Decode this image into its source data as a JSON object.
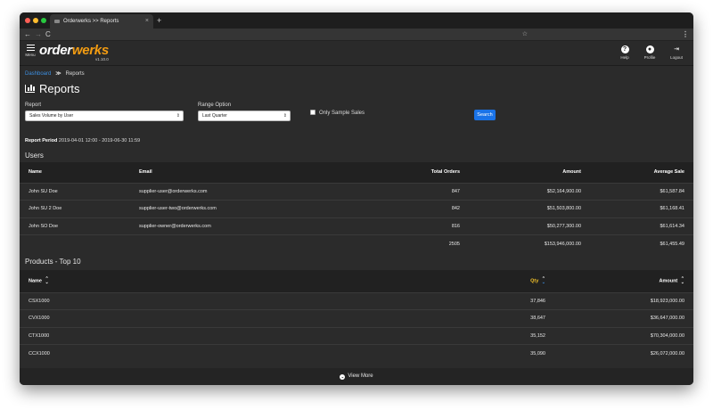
{
  "browser": {
    "tab_title": "Orderwerks >> Reports",
    "tab_close": "×",
    "new_tab": "+",
    "back": "←",
    "forward": "→",
    "reload": "C",
    "bookmark": "☆",
    "menu": "⋮"
  },
  "header": {
    "menu_label": "Menu",
    "logo_part1": "order",
    "logo_part2": "werks",
    "version": "v1.10.0",
    "actions": [
      {
        "label": "Help",
        "icon": "?"
      },
      {
        "label": "Profile",
        "icon": "●"
      },
      {
        "label": "Logout",
        "icon": "⇥"
      }
    ],
    "accent_color": "#f39c12"
  },
  "breadcrumb": {
    "home": "Dashboard",
    "separator": "≫",
    "current": "Reports"
  },
  "page_title": "Reports",
  "filters": {
    "report_label": "Report",
    "report_value": "Sales Volume by User",
    "range_label": "Range Option",
    "range_value": "Last Quarter",
    "dropdown_arrow": "⇕",
    "sample_label": "Only Sample Sales",
    "search_label": "Search"
  },
  "period": {
    "label": "Report Period",
    "value": "2019-04-01 12:00 - 2019-06-30 11:59"
  },
  "users": {
    "title": "Users",
    "columns": [
      "Name",
      "Email",
      "Total Orders",
      "Amount",
      "Average Sale"
    ],
    "rows": [
      [
        "John SU Doe",
        "supplier-user@orderwerks.com",
        "847",
        "$52,164,900.00",
        "$61,587.84"
      ],
      [
        "John SU 2 Doe",
        "supplier-user-two@orderwerks.com",
        "842",
        "$51,503,800.00",
        "$61,168.41"
      ],
      [
        "John SO Doe",
        "supplier-owner@orderwerks.com",
        "816",
        "$50,277,300.00",
        "$61,614.34"
      ]
    ],
    "totals": [
      "",
      "",
      "2505",
      "$153,946,000.00",
      "$61,455.49"
    ]
  },
  "products": {
    "title": "Products - Top 10",
    "columns": [
      "Name",
      "Qty",
      "Amount"
    ],
    "sort_up": "⌃",
    "sort_down": "⌄",
    "rows": [
      [
        "CSX1000",
        "37,846",
        "$18,923,000.00"
      ],
      [
        "CVX1000",
        "38,647",
        "$36,647,000.00"
      ],
      [
        "CTX1000",
        "35,152",
        "$70,304,000.00"
      ],
      [
        "CCX1000",
        "35,090",
        "$26,072,000.00"
      ]
    ],
    "active_sort_color": "#f3c228"
  },
  "view_more": {
    "icon": "⌄",
    "label": "View More"
  }
}
